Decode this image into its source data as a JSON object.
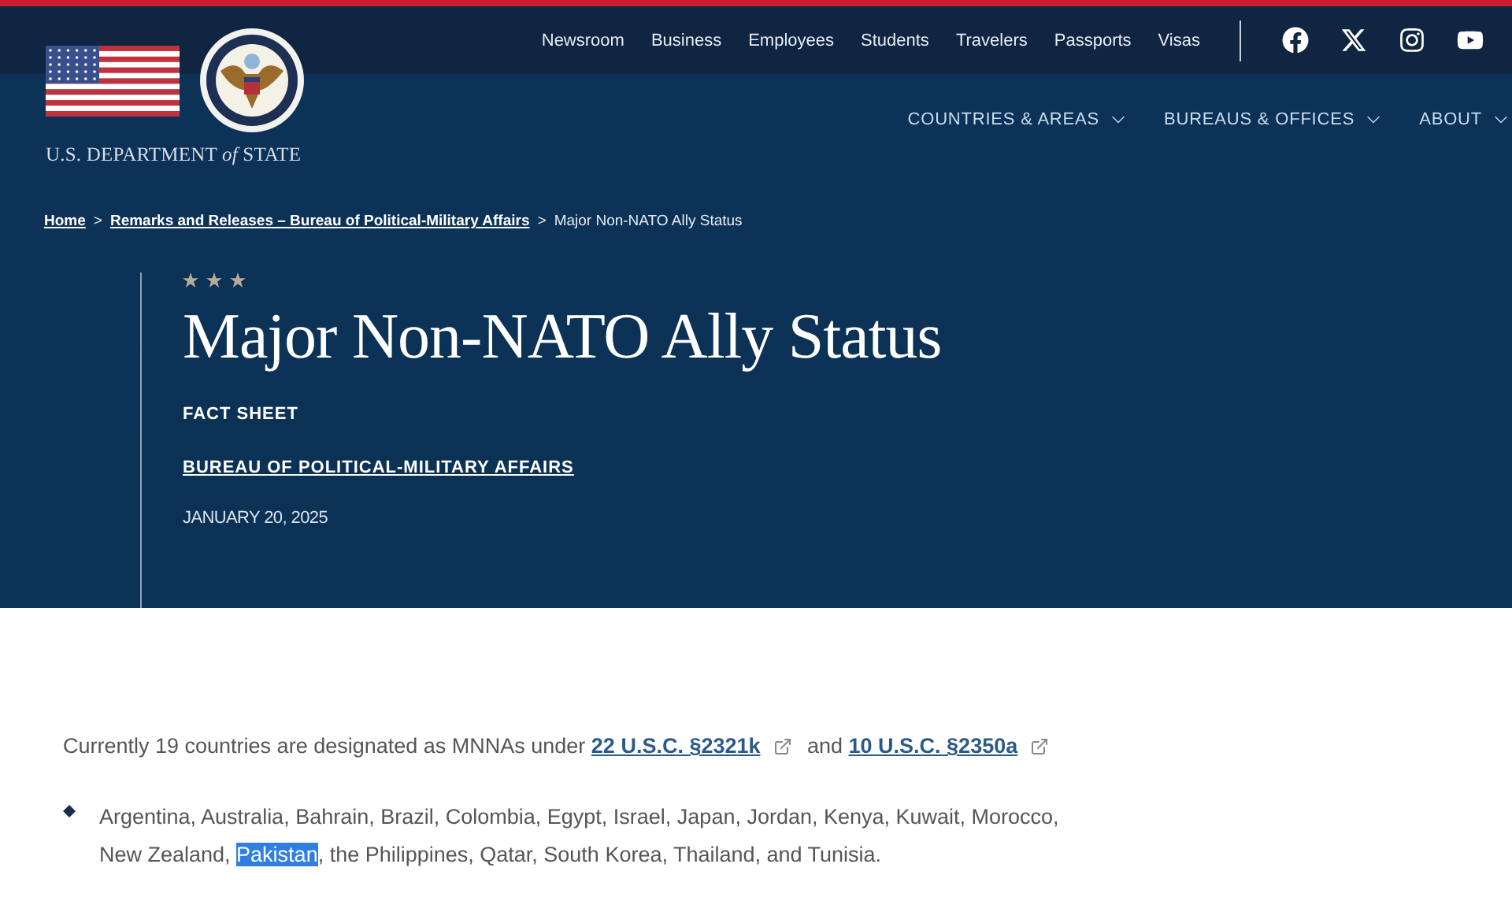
{
  "header": {
    "agency_name": {
      "before": "U.S. DEPARTMENT ",
      "middle": "of",
      "after": " STATE"
    },
    "utility_links": [
      "Newsroom",
      "Business",
      "Employees",
      "Students",
      "Travelers",
      "Passports",
      "Visas"
    ],
    "social": [
      {
        "kind": "facebook"
      },
      {
        "kind": "x"
      },
      {
        "kind": "instagram"
      },
      {
        "kind": "youtube"
      }
    ],
    "nav": [
      "COUNTRIES & AREAS",
      "BUREAUS & OFFICES",
      "ABOUT"
    ]
  },
  "breadcrumb": {
    "separator": ">",
    "items": [
      {
        "label": "Home",
        "link": true
      },
      {
        "label": "Remarks and Releases – Bureau of Political-Military Affairs",
        "link": true
      },
      {
        "label": "Major Non-NATO Ally Status",
        "link": false
      }
    ]
  },
  "hero": {
    "title": "Major Non-NATO Ally Status",
    "type": "FACT SHEET",
    "bureau": "BUREAU OF POLITICAL-MILITARY AFFAIRS",
    "date": "JANUARY 20, 2025"
  },
  "body": {
    "intro": [
      {
        "kind": "text",
        "text": "Currently 19 countries are designated as MNNAs under "
      },
      {
        "kind": "link",
        "text": "22 U.S.C. §2321k"
      },
      {
        "kind": "text",
        "text": " and "
      },
      {
        "kind": "link",
        "text": "10 U.S.C. §2350a"
      }
    ],
    "list": [
      {
        "parts": [
          {
            "text": "Argentina, Australia, Bahrain, Brazil, Colombia, Egypt, Israel, Japan, Jordan, Kenya, Kuwait, Morocco, New Zealand, ",
            "selected": false
          },
          {
            "text": "Pakistan",
            "selected": true
          },
          {
            "text": ", the Philippines, Qatar, South Korea, Thailand, and Tunisia.",
            "selected": false
          }
        ]
      }
    ]
  }
}
